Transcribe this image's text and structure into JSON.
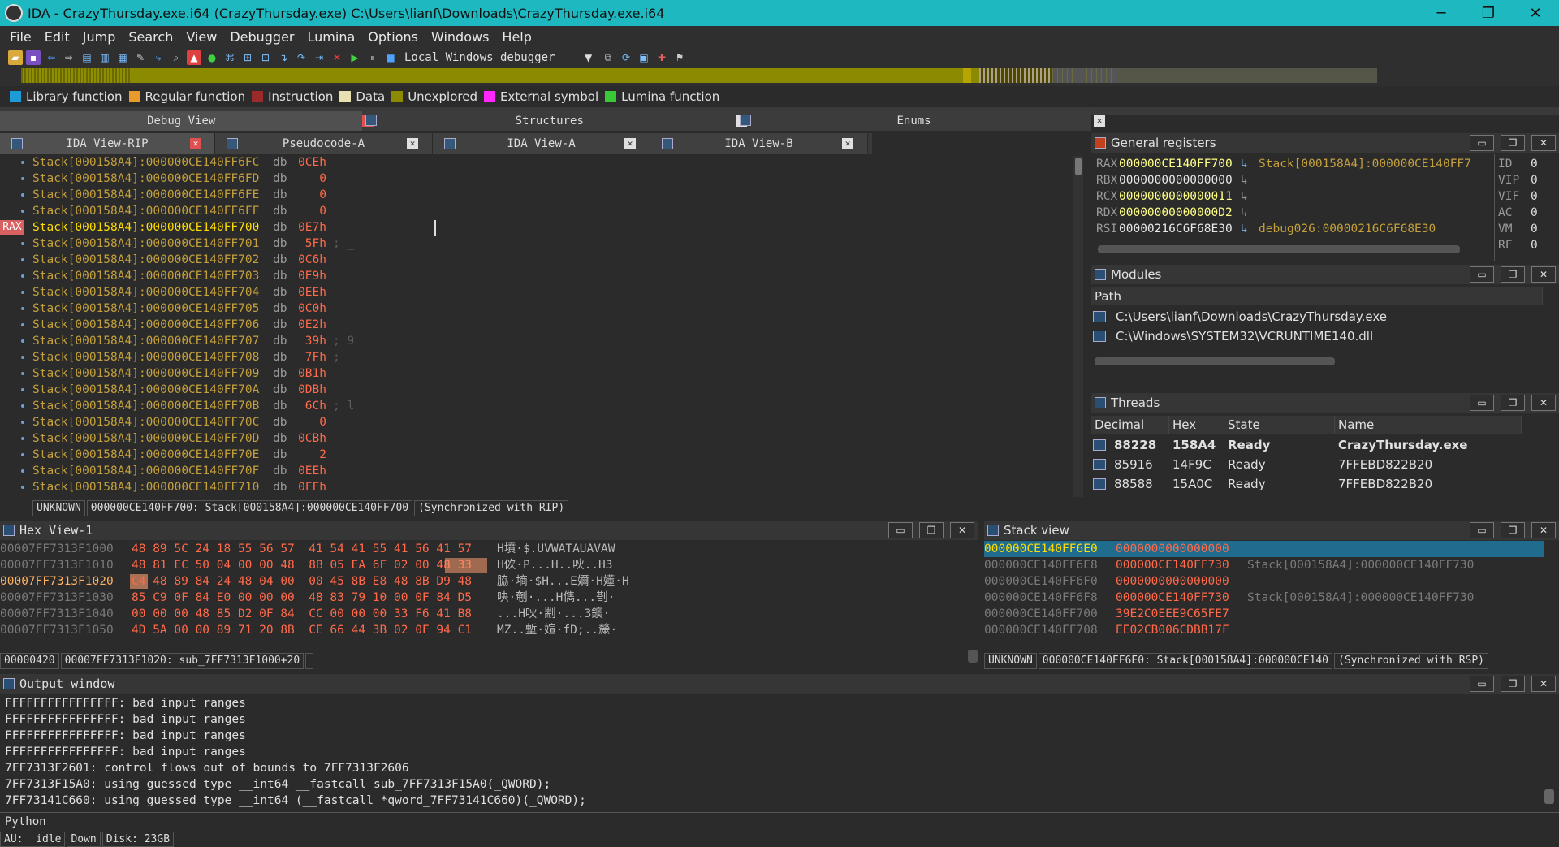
{
  "window": {
    "title": "IDA - CrazyThursday.exe.i64 (CrazyThursday.exe) C:\\Users\\lianf\\Downloads\\CrazyThursday.exe.i64",
    "minimize": "─",
    "maximize": "❐",
    "close": "✕"
  },
  "menu": [
    "File",
    "Edit",
    "Jump",
    "Search",
    "View",
    "Debugger",
    "Lumina",
    "Options",
    "Windows",
    "Help"
  ],
  "toolbar": {
    "debugger": "Local Windows debugger"
  },
  "legend": [
    {
      "label": "Library function",
      "color": "#1e9bd6"
    },
    {
      "label": "Regular function",
      "color": "#e89a2b"
    },
    {
      "label": "Instruction",
      "color": "#9b2a2a"
    },
    {
      "label": "Data",
      "color": "#e8e0b0"
    },
    {
      "label": "Unexplored",
      "color": "#8b8a00"
    },
    {
      "label": "External symbol",
      "color": "#ff26ff"
    },
    {
      "label": "Lumina function",
      "color": "#38c838"
    }
  ],
  "top_tabs": [
    "Debug View",
    "Structures",
    "Enums"
  ],
  "view_tabs": [
    "IDA View-RIP",
    "Pseudocode-A",
    "IDA View-A",
    "IDA View-B"
  ],
  "disasm": {
    "rax_tag": "RAX",
    "lines": [
      {
        "addr": "Stack[000158A4]:000000CE140FF6FC",
        "op": "db",
        "val": "0CEh",
        "cmt": ""
      },
      {
        "addr": "Stack[000158A4]:000000CE140FF6FD",
        "op": "db",
        "val": "0",
        "cmt": ""
      },
      {
        "addr": "Stack[000158A4]:000000CE140FF6FE",
        "op": "db",
        "val": "0",
        "cmt": ""
      },
      {
        "addr": "Stack[000158A4]:000000CE140FF6FF",
        "op": "db",
        "val": "0",
        "cmt": ""
      },
      {
        "addr": "Stack[000158A4]:000000CE140FF700",
        "op": "db",
        "val": "0E7h",
        "cmt": ""
      },
      {
        "addr": "Stack[000158A4]:000000CE140FF701",
        "op": "db",
        "val": "5Fh",
        "cmt": "; _"
      },
      {
        "addr": "Stack[000158A4]:000000CE140FF702",
        "op": "db",
        "val": "0C6h",
        "cmt": ""
      },
      {
        "addr": "Stack[000158A4]:000000CE140FF703",
        "op": "db",
        "val": "0E9h",
        "cmt": ""
      },
      {
        "addr": "Stack[000158A4]:000000CE140FF704",
        "op": "db",
        "val": "0EEh",
        "cmt": ""
      },
      {
        "addr": "Stack[000158A4]:000000CE140FF705",
        "op": "db",
        "val": "0C0h",
        "cmt": ""
      },
      {
        "addr": "Stack[000158A4]:000000CE140FF706",
        "op": "db",
        "val": "0E2h",
        "cmt": ""
      },
      {
        "addr": "Stack[000158A4]:000000CE140FF707",
        "op": "db",
        "val": "39h",
        "cmt": "; 9"
      },
      {
        "addr": "Stack[000158A4]:000000CE140FF708",
        "op": "db",
        "val": "7Fh",
        "cmt": ";"
      },
      {
        "addr": "Stack[000158A4]:000000CE140FF709",
        "op": "db",
        "val": "0B1h",
        "cmt": ""
      },
      {
        "addr": "Stack[000158A4]:000000CE140FF70A",
        "op": "db",
        "val": "0DBh",
        "cmt": ""
      },
      {
        "addr": "Stack[000158A4]:000000CE140FF70B",
        "op": "db",
        "val": "6Ch",
        "cmt": "; l"
      },
      {
        "addr": "Stack[000158A4]:000000CE140FF70C",
        "op": "db",
        "val": "0",
        "cmt": ""
      },
      {
        "addr": "Stack[000158A4]:000000CE140FF70D",
        "op": "db",
        "val": "0CBh",
        "cmt": ""
      },
      {
        "addr": "Stack[000158A4]:000000CE140FF70E",
        "op": "db",
        "val": "2",
        "cmt": ""
      },
      {
        "addr": "Stack[000158A4]:000000CE140FF70F",
        "op": "db",
        "val": "0EEh",
        "cmt": ""
      },
      {
        "addr": "Stack[000158A4]:000000CE140FF710",
        "op": "db",
        "val": "0FFh",
        "cmt": ""
      }
    ],
    "status": [
      "UNKNOWN",
      "000000CE140FF700: Stack[000158A4]:000000CE140FF700",
      "(Synchronized with RIP)"
    ]
  },
  "registers": {
    "title": "General registers",
    "rows": [
      {
        "name": "RAX",
        "value": "000000CE140FF700",
        "arrow": "↳",
        "target": "Stack[000158A4]:000000CE140FF7"
      },
      {
        "name": "RBX",
        "value": "0000000000000000",
        "arrow": "↳",
        "target": ""
      },
      {
        "name": "RCX",
        "value": "0000000000000011",
        "arrow": "↳",
        "target": ""
      },
      {
        "name": "RDX",
        "value": "00000000000000D2",
        "arrow": "↳",
        "target": ""
      },
      {
        "name": "RSI",
        "value": "00000216C6F68E30",
        "arrow": "↳",
        "target": "debug026:00000216C6F68E30"
      }
    ],
    "flags": [
      {
        "name": "ID",
        "value": "0"
      },
      {
        "name": "VIP",
        "value": "0"
      },
      {
        "name": "VIF",
        "value": "0"
      },
      {
        "name": "AC",
        "value": "0"
      },
      {
        "name": "VM",
        "value": "0"
      },
      {
        "name": "RF",
        "value": "0"
      }
    ]
  },
  "modules": {
    "title": "Modules",
    "header": "Path",
    "rows": [
      "C:\\Users\\lianf\\Downloads\\CrazyThursday.exe",
      "C:\\Windows\\SYSTEM32\\VCRUNTIME140.dll"
    ]
  },
  "threads": {
    "title": "Threads",
    "headers": [
      "Decimal",
      "Hex",
      "State",
      "Name"
    ],
    "rows": [
      {
        "dec": "88228",
        "hex": "158A4",
        "state": "Ready",
        "name": "CrazyThursday.exe"
      },
      {
        "dec": "85916",
        "hex": "14F9C",
        "state": "Ready",
        "name": "7FFEBD822B20"
      },
      {
        "dec": "88588",
        "hex": "15A0C",
        "state": "Ready",
        "name": "7FFEBD822B20"
      }
    ]
  },
  "hexview": {
    "title": "Hex View-1",
    "rows": [
      {
        "addr": "00007FF7313F1000",
        "bytes": "48 89 5C 24 18 55 56 57  41 54 41 55 41 56 41 57",
        "ascii": "H墳·$.UVWATAUAVAW"
      },
      {
        "addr": "00007FF7313F1010",
        "bytes": "48 81 EC 50 04 00 00 48  8B 05 EA 6F 02 00 48 33",
        "ascii": "H佽·P...H..吙..H3"
      },
      {
        "addr": "00007FF7313F1020",
        "bytes": "C4 48 89 84 24 48 04 00  00 45 8B E8 48 8B D9 48",
        "ascii": "脇·墒·$H...E嬭·H嬞·H"
      },
      {
        "addr": "00007FF7313F1030",
        "bytes": "85 C9 0F 84 E0 00 00 00  48 83 79 10 00 0F 84 D5",
        "ascii": "吷·剦·...H儁...剳·"
      },
      {
        "addr": "00007FF7313F1040",
        "bytes": "00 00 00 48 85 D2 0F 84  CC 00 00 00 33 F6 41 B8",
        "ascii": "...H吙·剬·...3鐭·"
      },
      {
        "addr": "00007FF7313F1050",
        "bytes": "4D 5A 00 00 89 71 20 8B  CE 66 44 3B 02 0F 94 C1",
        "ascii": "MZ..塹·媗·fD;..斄·"
      }
    ],
    "status": [
      "00000420",
      "00007FF7313F1020: sub_7FF7313F1000+20",
      ""
    ]
  },
  "stackview": {
    "title": "Stack view",
    "rows": [
      {
        "addr": "000000CE140FF6E0",
        "val": "0000000000000000",
        "cmt": ""
      },
      {
        "addr": "000000CE140FF6E8",
        "val": "000000CE140FF730",
        "cmt": "Stack[000158A4]:000000CE140FF730"
      },
      {
        "addr": "000000CE140FF6F0",
        "val": "0000000000000000",
        "cmt": ""
      },
      {
        "addr": "000000CE140FF6F8",
        "val": "000000CE140FF730",
        "cmt": "Stack[000158A4]:000000CE140FF730"
      },
      {
        "addr": "000000CE140FF700",
        "val": "39E2C0EEE9C65FE7",
        "cmt": ""
      },
      {
        "addr": "000000CE140FF708",
        "val": "EE02CB006CDBB17F",
        "cmt": ""
      }
    ],
    "status": [
      "UNKNOWN",
      "000000CE140FF6E0: Stack[000158A4]:000000CE140",
      "(Synchronized with RSP)"
    ]
  },
  "output": {
    "title": "Output window",
    "lines": [
      "FFFFFFFFFFFFFFFF: bad input ranges",
      "FFFFFFFFFFFFFFFF: bad input ranges",
      "FFFFFFFFFFFFFFFF: bad input ranges",
      "FFFFFFFFFFFFFFFF: bad input ranges",
      "7FF7313F2601: control flows out of bounds to 7FF7313F2606",
      "7FF7313F15A0: using guessed type __int64 __fastcall sub_7FF7313F15A0(_QWORD);",
      "7FF73141C660: using guessed type __int64 (__fastcall *qword_7FF73141C660)(_QWORD);"
    ],
    "python": "Python"
  },
  "statusbar": [
    "AU:  idle",
    "Down",
    "Disk: 23GB"
  ]
}
